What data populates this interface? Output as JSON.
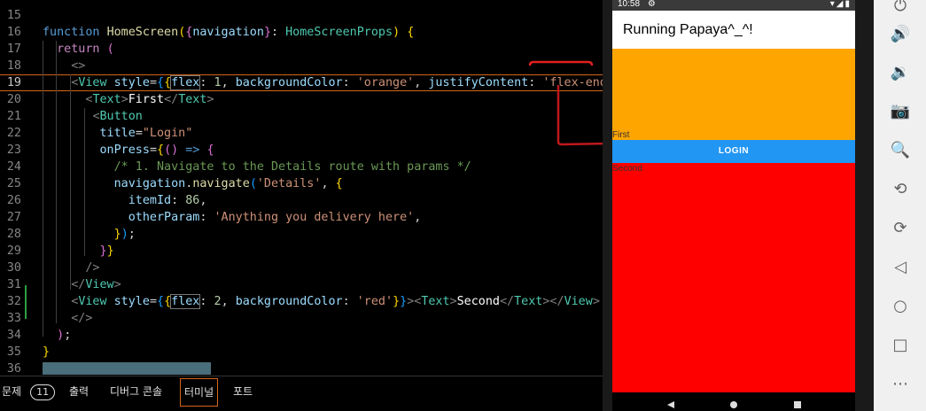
{
  "editor": {
    "lines": [
      {
        "n": "15",
        "html": ""
      },
      {
        "n": "16",
        "html": "<span class='k-kw'>function</span> <span class='k-fn'>HomeScreen</span><span class='k-b1'>(</span><span class='k-b2'>{</span><span class='k-var'>navigation</span><span class='k-b2'>}</span>: <span class='k-type'>HomeScreenProps</span><span class='k-b1'>)</span> <span class='k-b1'>{</span>"
      },
      {
        "n": "17",
        "html": "  <span class='k-ctl'>return</span> <span class='k-b2'>(</span>"
      },
      {
        "n": "18",
        "html": "    <span class='k-br'>&lt;&gt;</span>"
      },
      {
        "n": "19",
        "html": "    <span class='k-br'>&lt;</span><span class='k-tag'>View</span> <span class='k-var'>style</span>=<span class='k-b3'>{</span><span class='k-b1'>{</span><span class='k-var hl-box'>flex</span>: <span class='k-num'>1</span>, <span class='k-var'>backgroundColor</span>: <span class='k-str'>'orange'</span>, <span class='k-var'>justifyContent</span>: <span class='k-str'>'flex-end'</span><span class='k-b1'>}</span>"
      },
      {
        "n": "20",
        "html": "      <span class='k-br'>&lt;</span><span class='k-tag'>Text</span><span class='k-br'>&gt;</span><span class='k-txt'>First</span><span class='k-br'>&lt;/</span><span class='k-tag'>Text</span><span class='k-br'>&gt;</span>"
      },
      {
        "n": "21",
        "html": "       <span class='k-br'>&lt;</span><span class='k-tag'>Button</span>"
      },
      {
        "n": "22",
        "html": "        <span class='k-var'>title</span>=<span class='k-str'>\"Login\"</span>"
      },
      {
        "n": "23",
        "html": "        <span class='k-var'>onPress</span>=<span class='k-b1'>{</span><span class='k-b2'>()</span> <span class='k-kw'>=&gt;</span> <span class='k-b2'>{</span>"
      },
      {
        "n": "24",
        "html": "          <span class='k-cmt'>/* 1. Navigate to the Details route with params */</span>"
      },
      {
        "n": "25",
        "html": "          <span class='k-var'>navigation</span>.<span class='k-fn'>navigate</span><span class='k-b3'>(</span><span class='k-str'>'Details'</span>, <span class='k-b1'>{</span>"
      },
      {
        "n": "26",
        "html": "            <span class='k-var'>itemId</span>: <span class='k-num'>86</span>,"
      },
      {
        "n": "27",
        "html": "            <span class='k-var'>otherParam</span>: <span class='k-str'>'Anything you delivery here'</span>,"
      },
      {
        "n": "28",
        "html": "          <span class='k-b1'>}</span><span class='k-b3'>)</span>;"
      },
      {
        "n": "29",
        "html": "        <span class='k-b2'>}</span><span class='k-b1'>}</span>"
      },
      {
        "n": "30",
        "html": "      <span class='k-br'>/&gt;</span>"
      },
      {
        "n": "31",
        "html": "    <span class='k-br'>&lt;/</span><span class='k-tag'>View</span><span class='k-br'>&gt;</span>"
      },
      {
        "n": "32",
        "html": "    <span class='k-br'>&lt;</span><span class='k-tag'>View</span> <span class='k-var'>style</span>=<span class='k-b3'>{</span><span class='k-b1'>{</span><span class='k-var hl-box'>flex</span>: <span class='k-num'>2</span>, <span class='k-var'>backgroundColor</span>: <span class='k-str'>'red'</span><span class='k-b1'>}</span><span class='k-b3'>}</span><span class='k-br'>&gt;&lt;</span><span class='k-tag'>Text</span><span class='k-br'>&gt;</span><span class='k-txt'>Second</span><span class='k-br'>&lt;/</span><span class='k-tag'>Text</span><span class='k-br'>&gt;&lt;/</span><span class='k-tag'>View</span><span class='k-br'>&gt;</span>"
      },
      {
        "n": "33",
        "html": "    <span class='k-br'>&lt;/&gt;</span>"
      },
      {
        "n": "34",
        "html": "  <span class='k-b2'>)</span>;"
      },
      {
        "n": "35",
        "html": "<span class='k-b1'>}</span>"
      },
      {
        "n": "36",
        "html": ""
      }
    ],
    "active_line": "19"
  },
  "panel": {
    "tabs": [
      {
        "label": "문제",
        "badge": "11"
      },
      {
        "label": "출력"
      },
      {
        "label": "디버그 콘솔"
      },
      {
        "label": "터미널",
        "active": true
      },
      {
        "label": "포트"
      }
    ]
  },
  "emulator": {
    "time": "10:58",
    "app_title": "Running Papaya^_^!",
    "first_text": "First",
    "button_label": "LOGIN",
    "second_text": "Second",
    "top_view_color": "#ffa500",
    "bottom_view_color": "#ff0000",
    "button_color": "#2196f3"
  },
  "toolbar": {
    "buttons": [
      {
        "name": "power-icon",
        "glyph": "⏻"
      },
      {
        "name": "volume-up-icon",
        "glyph": "🔊"
      },
      {
        "name": "volume-down-icon",
        "glyph": "🔉"
      },
      {
        "name": "camera-icon",
        "glyph": "📷"
      },
      {
        "name": "zoom-icon",
        "glyph": "🔍"
      },
      {
        "name": "rotate-left-icon",
        "glyph": "⟲"
      },
      {
        "name": "rotate-right-icon",
        "glyph": "⟳"
      },
      {
        "name": "back-icon",
        "glyph": "◁"
      },
      {
        "name": "home-icon",
        "glyph": "○"
      },
      {
        "name": "overview-icon",
        "glyph": "□"
      },
      {
        "name": "more-icon",
        "glyph": "⋯"
      }
    ]
  }
}
